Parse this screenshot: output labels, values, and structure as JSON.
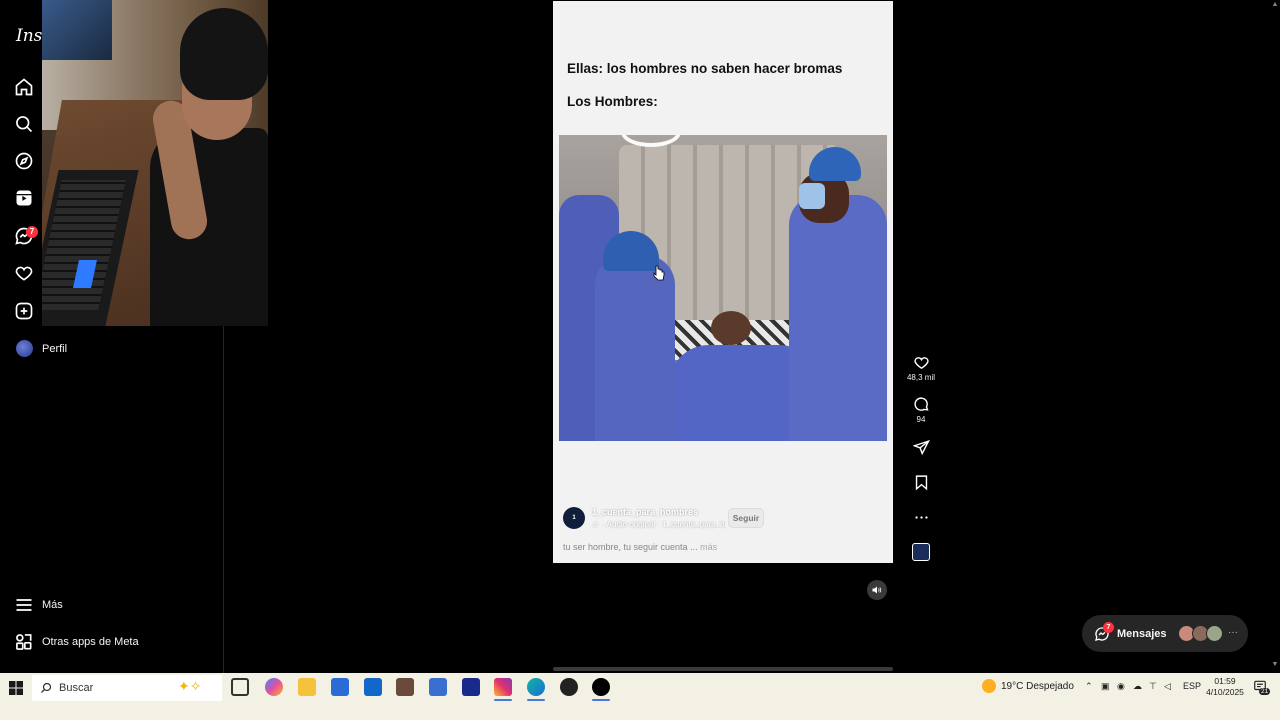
{
  "app": {
    "logo_text": "Inst"
  },
  "sidebar": {
    "notifications_badge": "7",
    "profile_label": "Perfil",
    "more_label": "Más",
    "meta_apps_label": "Otras apps de Meta"
  },
  "post": {
    "caption_line_1": "Ellas: los hombres no saben hacer bromas",
    "caption_line_2": "Los Hombres:",
    "author": "1_cuenta_para_hombres",
    "audio": "♬ · Audio original · 1_cuenta_para_hombres",
    "follow_label": "Seguir",
    "description": "tu ser hombre, tu seguir cuenta ...",
    "more_label": "más",
    "avatar_text": "1"
  },
  "actions": {
    "likes": "48,3 mil",
    "comments": "94"
  },
  "messages": {
    "label": "Mensajes",
    "badge": "7"
  },
  "taskbar": {
    "search_label": "Buscar",
    "weather_text": "19°C  Despejado",
    "language": "ESP",
    "time": "01:59",
    "date": "4/10/2025",
    "notif_count": "21"
  },
  "colors": {
    "accent_badge": "#ff3040",
    "background": "#000000",
    "post_bg": "#f2f2f2",
    "taskbar_bg": "#f3f0e4"
  }
}
